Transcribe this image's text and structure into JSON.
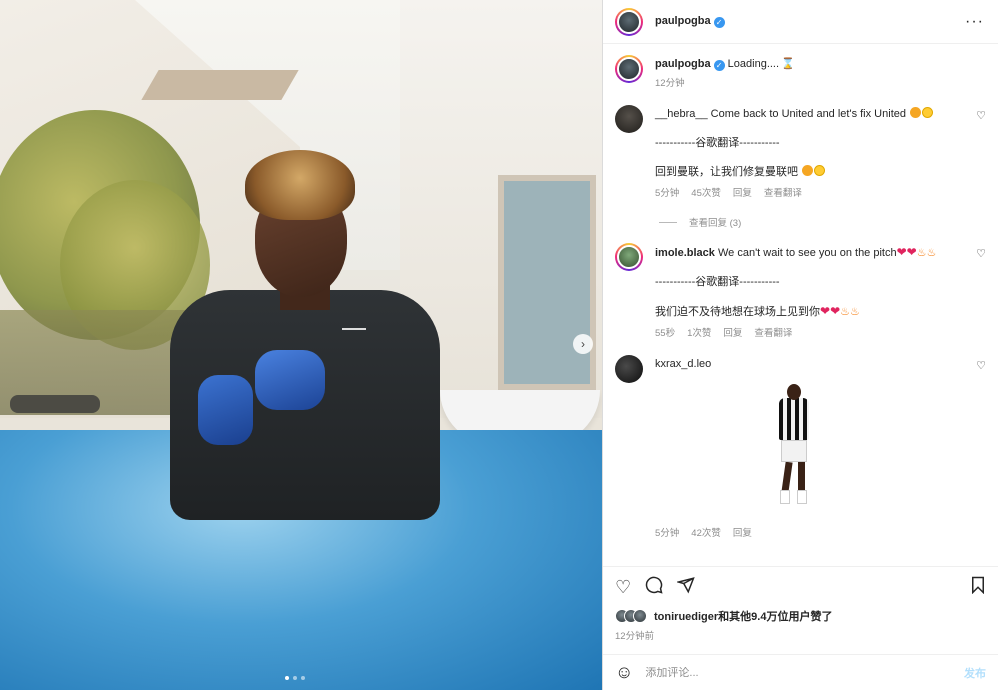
{
  "header": {
    "username": "paulpogba",
    "more_label": "···"
  },
  "caption": {
    "username": "paulpogba",
    "text": "Loading....",
    "time": "12分钟"
  },
  "comments": [
    {
      "username": "__hebra__",
      "text": "Come back to United and let's fix United",
      "translate_divider": "-----------谷歌翻译-----------",
      "translation": "回到曼联，让我们修复曼联吧",
      "time": "5分钟",
      "likes": "45次赞",
      "reply": "回复",
      "see_translation": "查看翻译",
      "view_replies": "查看回复 (3)"
    },
    {
      "username": "imole.black",
      "text": "We can't wait to see you on the pitch",
      "translate_divider": "-----------谷歌翻译-----------",
      "translation": "我们迫不及待地想在球场上见到你",
      "time": "55秒",
      "likes": "1次赞",
      "reply": "回复",
      "see_translation": "查看翻译"
    },
    {
      "username": "kxrax_d.leo",
      "time": "5分钟",
      "likes": "42次赞",
      "reply": "回复"
    }
  ],
  "likes": {
    "liker": "toniruediger",
    "text": "和其他9.4万位用户赞了",
    "time": "12分钟前"
  },
  "add_comment": {
    "placeholder": "添加评论...",
    "post_label": "发布"
  },
  "icons": {
    "verified": "verified-badge-icon",
    "like": "heart-icon",
    "comment": "comment-icon",
    "share": "send-icon",
    "save": "bookmark-icon",
    "emoji": "emoji-icon",
    "next": "chevron-right-icon"
  },
  "colors": {
    "accent": "#3897f0",
    "muted": "#8e8e8e",
    "post_disabled": "#b2dffc"
  }
}
